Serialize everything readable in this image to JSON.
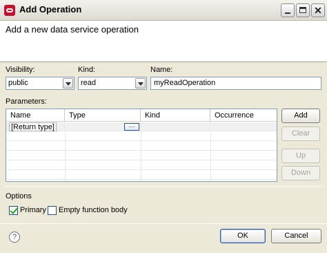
{
  "window": {
    "title": "Add Operation"
  },
  "header": {
    "title": "Add a new data service operation"
  },
  "form": {
    "visibility_label": "Visibility:",
    "visibility_value": "public",
    "kind_label": "Kind:",
    "kind_value": "read",
    "name_label": "Name:",
    "name_value": "myReadOperation"
  },
  "parameters": {
    "label": "Parameters:",
    "columns": [
      "Name",
      "Type",
      "Kind",
      "Occurrence"
    ],
    "rows": [
      {
        "name": "[Return type]",
        "type": "",
        "kind": "",
        "occurrence": "",
        "browse_label": "...."
      }
    ],
    "buttons": {
      "add": "Add",
      "clear": "Clear",
      "up": "Up",
      "down": "Down"
    }
  },
  "options": {
    "label": "Options",
    "primary_label": "Primary",
    "primary_checked": true,
    "empty_body_label": "Empty function body",
    "empty_body_checked": false
  },
  "footer": {
    "help": "?",
    "ok": "OK",
    "cancel": "Cancel"
  }
}
